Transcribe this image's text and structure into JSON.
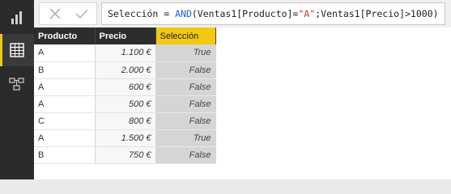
{
  "formula": {
    "pre": "Selección = ",
    "fn": "AND",
    "mid": "(Ventas1[Producto]=",
    "str": "\"A\"",
    "post": ";Ventas1[Precio]>1000)"
  },
  "table": {
    "headers": [
      "Producto",
      "Precio",
      "Selección"
    ],
    "rows": [
      [
        "A",
        "1.100 €",
        "True"
      ],
      [
        "B",
        "2.000 €",
        "False"
      ],
      [
        "A",
        "600 €",
        "False"
      ],
      [
        "A",
        "500 €",
        "False"
      ],
      [
        "C",
        "800 €",
        "False"
      ],
      [
        "A",
        "1.500 €",
        "True"
      ],
      [
        "B",
        "750 €",
        "False"
      ]
    ]
  },
  "colors": {
    "accent": "#f2c811",
    "keyword": "#1e5cd8",
    "string": "#c0392b"
  },
  "icons": [
    "report-view-icon",
    "data-view-icon",
    "model-view-icon",
    "cancel-icon",
    "commit-icon"
  ]
}
